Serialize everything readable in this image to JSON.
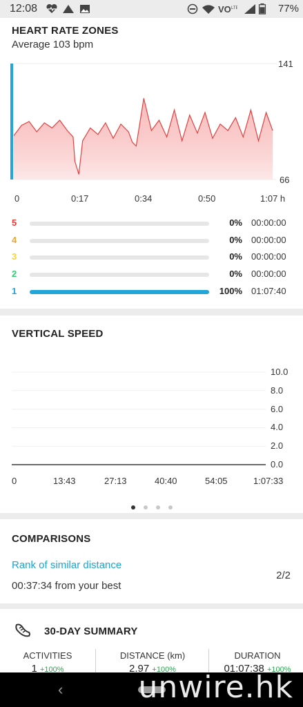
{
  "status_bar": {
    "time": "12:08",
    "battery": "77%",
    "icons": [
      "heart-rate-icon",
      "triangle-icon",
      "image-icon",
      "do-not-disturb-icon",
      "wifi-icon",
      "volte-icon",
      "signal-icon",
      "battery-icon"
    ]
  },
  "heart_rate": {
    "title": "HEART RATE ZONES",
    "average": "Average 103 bpm",
    "y_max_label": "141",
    "y_min_label": "66",
    "x_ticks": [
      "0",
      "0:17",
      "0:34",
      "0:50",
      "1:07 h"
    ],
    "zones": [
      {
        "num": "5",
        "color": "#e53935",
        "pct": "0%",
        "time": "00:00:00",
        "fraction": 0
      },
      {
        "num": "4",
        "color": "#f5a623",
        "pct": "0%",
        "time": "00:00:00",
        "fraction": 0
      },
      {
        "num": "3",
        "color": "#f2d43a",
        "pct": "0%",
        "time": "00:00:00",
        "fraction": 0
      },
      {
        "num": "2",
        "color": "#2ecc71",
        "pct": "0%",
        "time": "00:00:00",
        "fraction": 0
      },
      {
        "num": "1",
        "color": "#22a6d9",
        "pct": "100%",
        "time": "01:07:40",
        "fraction": 1
      }
    ]
  },
  "vertical_speed": {
    "title": "VERTICAL SPEED",
    "y_ticks": [
      "10.0",
      "8.0",
      "6.0",
      "4.0",
      "2.0",
      "0.0"
    ],
    "x_ticks": [
      "0",
      "13:43",
      "27:13",
      "40:40",
      "54:05",
      "1:07:33"
    ],
    "pager_count": 4,
    "pager_active": 0
  },
  "comparisons": {
    "title": "COMPARISONS",
    "link": "Rank of similar distance",
    "detail": "00:37:34 from your best",
    "rank": "2/2"
  },
  "summary": {
    "title": "30-DAY SUMMARY",
    "columns": [
      {
        "label": "ACTIVITIES",
        "value": "1",
        "change": "+100%"
      },
      {
        "label": "DISTANCE (km)",
        "value": "2.97",
        "change": "+100%"
      },
      {
        "label": "DURATION",
        "value": "01:07:38",
        "change": "+100%"
      }
    ]
  },
  "watermark": "unwire.hk",
  "chart_data": [
    {
      "type": "area",
      "title": "HEART RATE ZONES",
      "xlabel": "",
      "ylabel": "",
      "ylim": [
        66,
        141
      ],
      "x_ticks": [
        "0",
        "0:17",
        "0:34",
        "0:50",
        "1:07 h"
      ],
      "series": [
        {
          "x_minutes": [
            0,
            2,
            4,
            6,
            8,
            10,
            12,
            14,
            15.5,
            16,
            17,
            18,
            20,
            22,
            24,
            26,
            28,
            30,
            31,
            32,
            34,
            36,
            38,
            40,
            42,
            44,
            46,
            48,
            50,
            52,
            54,
            56,
            58,
            60,
            62,
            64,
            66,
            67.7
          ],
          "values": [
            100,
            108,
            111,
            103,
            110,
            106,
            112,
            104,
            99,
            80,
            70,
            96,
            106,
            101,
            110,
            98,
            109,
            103,
            95,
            92,
            129,
            104,
            112,
            99,
            120,
            96,
            116,
            102,
            118,
            98,
            109,
            104,
            114,
            99,
            120,
            96,
            118,
            104
          ]
        }
      ],
      "grid": false,
      "legend": "none"
    },
    {
      "type": "line",
      "title": "VERTICAL SPEED",
      "xlabel": "",
      "ylabel": "",
      "ylim": [
        0,
        10
      ],
      "y_ticks": [
        0,
        2,
        4,
        6,
        8,
        10
      ],
      "x_ticks": [
        "0",
        "13:43",
        "27:13",
        "40:40",
        "54:05",
        "1:07:33"
      ],
      "series": [
        {
          "x_minutes": [
            0,
            67.55
          ],
          "values": [
            0,
            0
          ]
        }
      ],
      "grid": true,
      "legend": "none"
    }
  ]
}
